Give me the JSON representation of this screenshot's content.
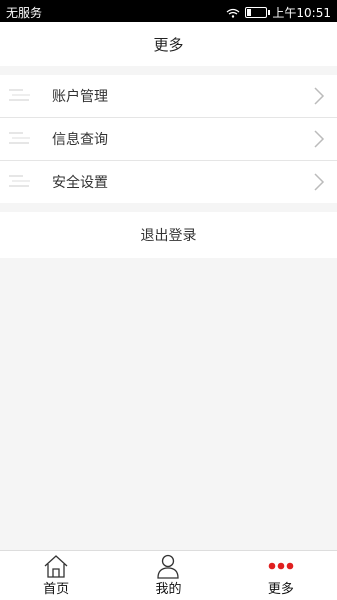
{
  "status_bar": {
    "carrier": "无服务",
    "time": "上午10:51"
  },
  "header": {
    "title": "更多"
  },
  "menu": [
    {
      "label": "账户管理",
      "icon": "account-icon"
    },
    {
      "label": "信息查询",
      "icon": "info-icon"
    },
    {
      "label": "安全设置",
      "icon": "security-icon"
    }
  ],
  "logout": {
    "label": "退出登录"
  },
  "tabbar": {
    "tabs": [
      {
        "label": "首页",
        "icon": "home-icon"
      },
      {
        "label": "我的",
        "icon": "user-icon"
      },
      {
        "label": "更多",
        "icon": "more-icon"
      }
    ],
    "active_color": "#e02020"
  },
  "colors": {
    "background": "#f5f5f5",
    "status_bar": "#000000"
  }
}
